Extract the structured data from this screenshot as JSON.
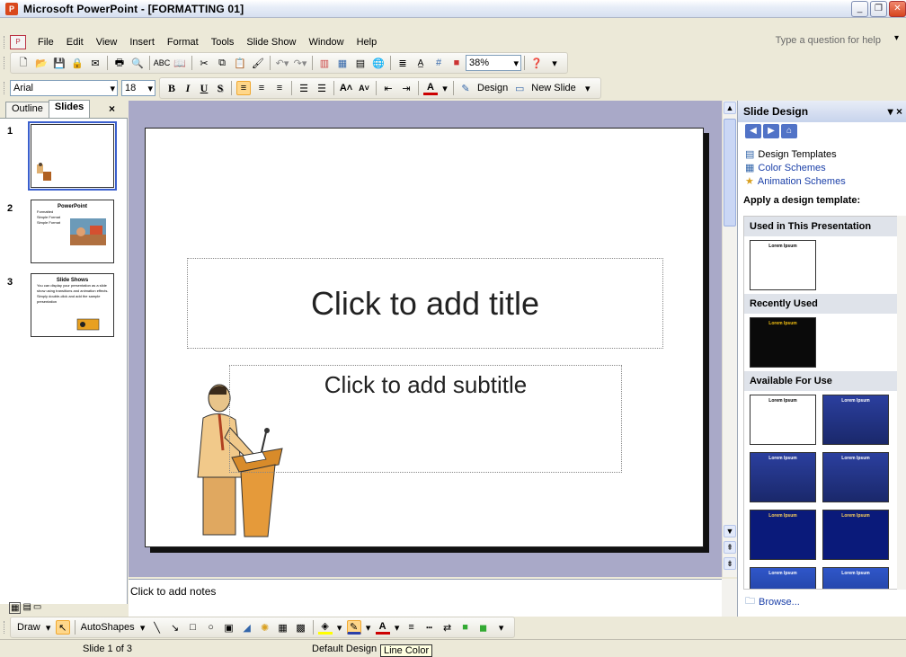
{
  "window": {
    "title": "Microsoft PowerPoint - [FORMATTING 01]"
  },
  "menu": {
    "items": [
      "File",
      "Edit",
      "View",
      "Insert",
      "Format",
      "Tools",
      "Slide Show",
      "Window",
      "Help"
    ],
    "help_placeholder": "Type a question for help"
  },
  "toolbar_standard": {
    "zoom": "38%"
  },
  "toolbar_formatting": {
    "font": "Arial",
    "size": "18",
    "bold": "B",
    "italic": "I",
    "underline": "U",
    "shadow": "S",
    "design_label": "Design",
    "new_slide_label": "New Slide"
  },
  "left_pane": {
    "tabs": [
      "Outline",
      "Slides"
    ],
    "close": "×",
    "slides": [
      {
        "number": "1"
      },
      {
        "number": "2",
        "title": "PowerPoint",
        "bullets": [
          "Formatted",
          "Simple Format",
          "Simple Format"
        ]
      },
      {
        "number": "3",
        "title": "Slide Shows",
        "bullets": [
          "You can display your presentation as a slide show using transitions and animation effects.",
          "Simply double-click and add the sample presentation"
        ]
      }
    ]
  },
  "slide": {
    "title_placeholder": "Click to add title",
    "subtitle_placeholder": "Click to add subtitle"
  },
  "notes": {
    "placeholder": "Click to add notes"
  },
  "task_pane": {
    "title": "Slide Design",
    "links": [
      "Design Templates",
      "Color Schemes",
      "Animation Schemes"
    ],
    "apply_label": "Apply a design template:",
    "sections": [
      "Used in This Presentation",
      "Recently Used",
      "Available For Use"
    ],
    "template_text": "Lorem Ipsum",
    "browse_label": "Browse..."
  },
  "drawing_toolbar": {
    "draw_label": "Draw",
    "autoshapes_label": "AutoShapes"
  },
  "status_bar": {
    "slide_info": "Slide 1 of 3",
    "design": "Default Design",
    "tooltip": "Line Color"
  },
  "colors": {
    "accent_blue": "#1a3fa8",
    "slide_area": "#a9a9c8",
    "title_bar": "#d6dff0"
  }
}
